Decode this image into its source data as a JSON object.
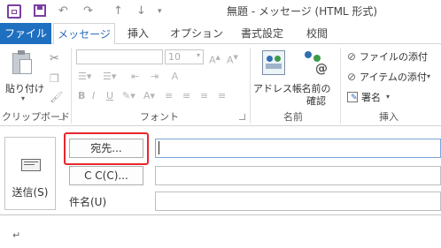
{
  "window": {
    "title": "無題 - メッセージ (HTML 形式)"
  },
  "quick_access": {
    "icons": [
      "outlook-icon",
      "save-icon",
      "undo-icon",
      "redo-icon",
      "up-arrow-icon",
      "down-arrow-icon",
      "customize-icon"
    ]
  },
  "tabs": [
    {
      "label": "ファイル"
    },
    {
      "label": "メッセージ"
    },
    {
      "label": "挿入"
    },
    {
      "label": "オプション"
    },
    {
      "label": "書式設定"
    },
    {
      "label": "校閲"
    }
  ],
  "ribbon": {
    "clipboard": {
      "paste_label": "貼り付け",
      "group_label": "クリップボード"
    },
    "font": {
      "size_value": "10",
      "group_label": "フォント"
    },
    "names": {
      "address_book_label": "アドレス帳",
      "check_names_label_1": "名前の",
      "check_names_label_2": "確認",
      "group_label": "名前"
    },
    "include": {
      "attach_file_label": "ファイルの添付",
      "attach_item_label": "アイテムの添付",
      "signature_label": "署名",
      "group_label": "挿入"
    }
  },
  "compose": {
    "send_label": "送信(S)",
    "to_button": "宛先...",
    "cc_button": "C C(C)...",
    "subject_label": "件名(U)",
    "to_value": "",
    "cc_value": "",
    "subject_value": "",
    "body_mark": "↵"
  },
  "colors": {
    "file_tab": "#1e6fbf",
    "accent": "#2a6cbf",
    "highlight": "#e8262e"
  }
}
